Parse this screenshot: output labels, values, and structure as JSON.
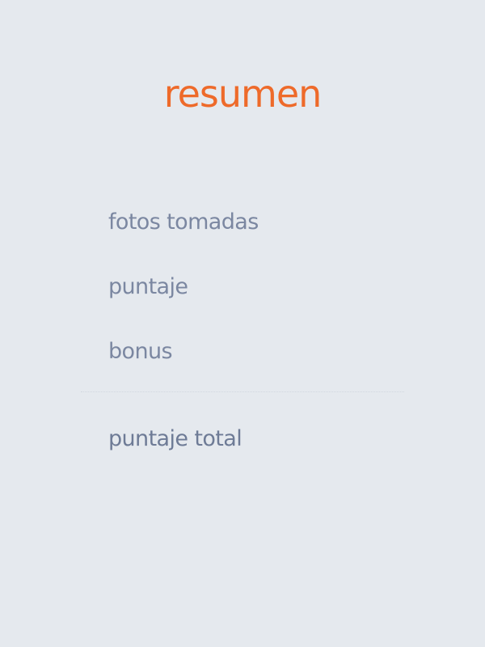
{
  "page": {
    "title": "resumen",
    "accent_color": "#ee6a2a",
    "text_color": "#7b87a1",
    "background_color": "#e5e9ee"
  },
  "summary": {
    "items": [
      {
        "label": "fotos tomadas"
      },
      {
        "label": "puntaje"
      },
      {
        "label": "bonus"
      }
    ],
    "total_label": "puntaje total"
  }
}
